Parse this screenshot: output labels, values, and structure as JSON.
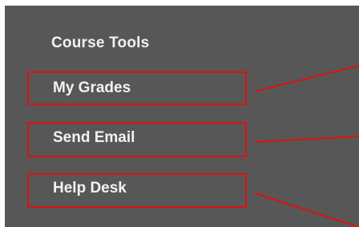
{
  "course_tools": {
    "heading": "Course Tools",
    "items": [
      {
        "label": "My Grades"
      },
      {
        "label": "Send Email"
      },
      {
        "label": "Help Desk"
      }
    ]
  },
  "colors": {
    "panel_background": "#575757",
    "text": "#f2f2f2",
    "highlight_outline": "#e01010"
  }
}
